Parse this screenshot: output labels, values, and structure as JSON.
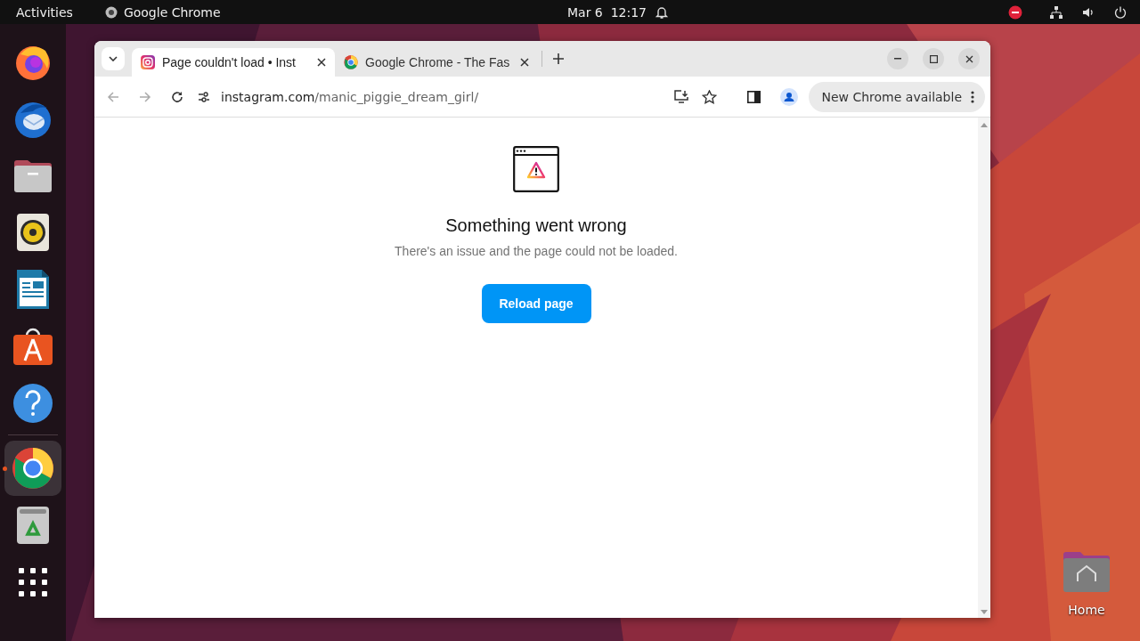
{
  "top_bar": {
    "activities": "Activities",
    "app": "Google Chrome",
    "clock": "Mar 6  12:17"
  },
  "dock": [
    {
      "kind": "firefox",
      "selected": false
    },
    {
      "kind": "thunderbird",
      "selected": false
    },
    {
      "kind": "files",
      "selected": false
    },
    {
      "kind": "rhythmbox",
      "selected": false
    },
    {
      "kind": "writer",
      "selected": false
    },
    {
      "kind": "appcenter",
      "selected": false
    },
    {
      "kind": "help",
      "selected": false
    },
    {
      "kind": "chrome",
      "selected": true
    },
    {
      "kind": "trash",
      "selected": false
    },
    {
      "kind": "apps",
      "selected": false
    }
  ],
  "tabs": [
    {
      "title": "Page couldn't load • Inst",
      "kind": "instagram",
      "selected": true
    },
    {
      "title": "Google Chrome - The Fas",
      "kind": "chrome",
      "selected": false
    }
  ],
  "address": {
    "domain": "instagram.com",
    "path": "/manic_piggie_dream_girl/"
  },
  "update_button": "New Chrome available",
  "page": {
    "heading": "Something went wrong",
    "message": "There's an issue and the page could not be loaded.",
    "button": "Reload page"
  },
  "desktop_icons": [
    {
      "label": "Home"
    }
  ]
}
